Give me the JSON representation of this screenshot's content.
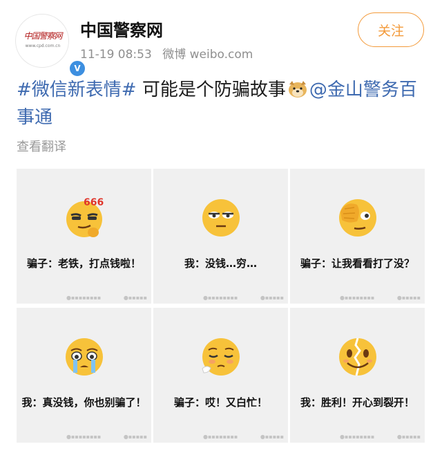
{
  "account": {
    "avatar_text": "中国警察网",
    "avatar_url": "www.cpd.com.cn",
    "verified_badge": "V",
    "name": "中国警察网",
    "timestamp": "11-19 08:53",
    "source": "微博 weibo.com"
  },
  "follow_label": "关注",
  "post": {
    "hashtag": "#微信新表情#",
    "text": " 可能是个防骗故事",
    "emoji": "doge-icon",
    "mention": "@金山警务百事通"
  },
  "translate_label": "查看翻译",
  "images": [
    {
      "emoji": "666-smirk-icon",
      "caption": "骗子：老铁，打点钱啦！"
    },
    {
      "emoji": "eye-roll-icon",
      "caption": "我：没钱…穷…"
    },
    {
      "emoji": "facepalm-peek-icon",
      "caption": "骗子：让我看看打了没？"
    },
    {
      "emoji": "crying-icon",
      "caption": "我：真没钱，你也别骗了！"
    },
    {
      "emoji": "sigh-icon",
      "caption": "骗子：哎！又白忙！"
    },
    {
      "emoji": "cracked-smile-icon",
      "caption": "我：胜利！开心到裂开！"
    }
  ],
  "colors": {
    "link": "#3e6ab0",
    "follow": "#f39a3a",
    "emoji_yellow": "#f7c23a"
  }
}
